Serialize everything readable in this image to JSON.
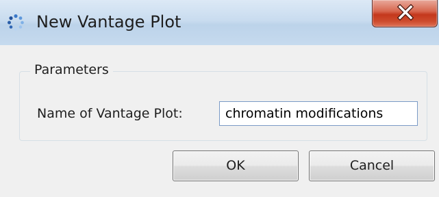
{
  "window": {
    "title": "New Vantage Plot",
    "app_icon": "app-icon",
    "close_icon": "close-icon"
  },
  "parameters": {
    "legend": "Parameters",
    "name_label": "Name of Vantage Plot:",
    "name_value": "chromatin modifications"
  },
  "buttons": {
    "ok_label": "OK",
    "cancel_label": "Cancel"
  },
  "colors": {
    "titlebar": "#c9dcef",
    "close_button": "#c4381c",
    "dialog_background": "#f0f0f0",
    "input_border": "#7a9ac6"
  }
}
